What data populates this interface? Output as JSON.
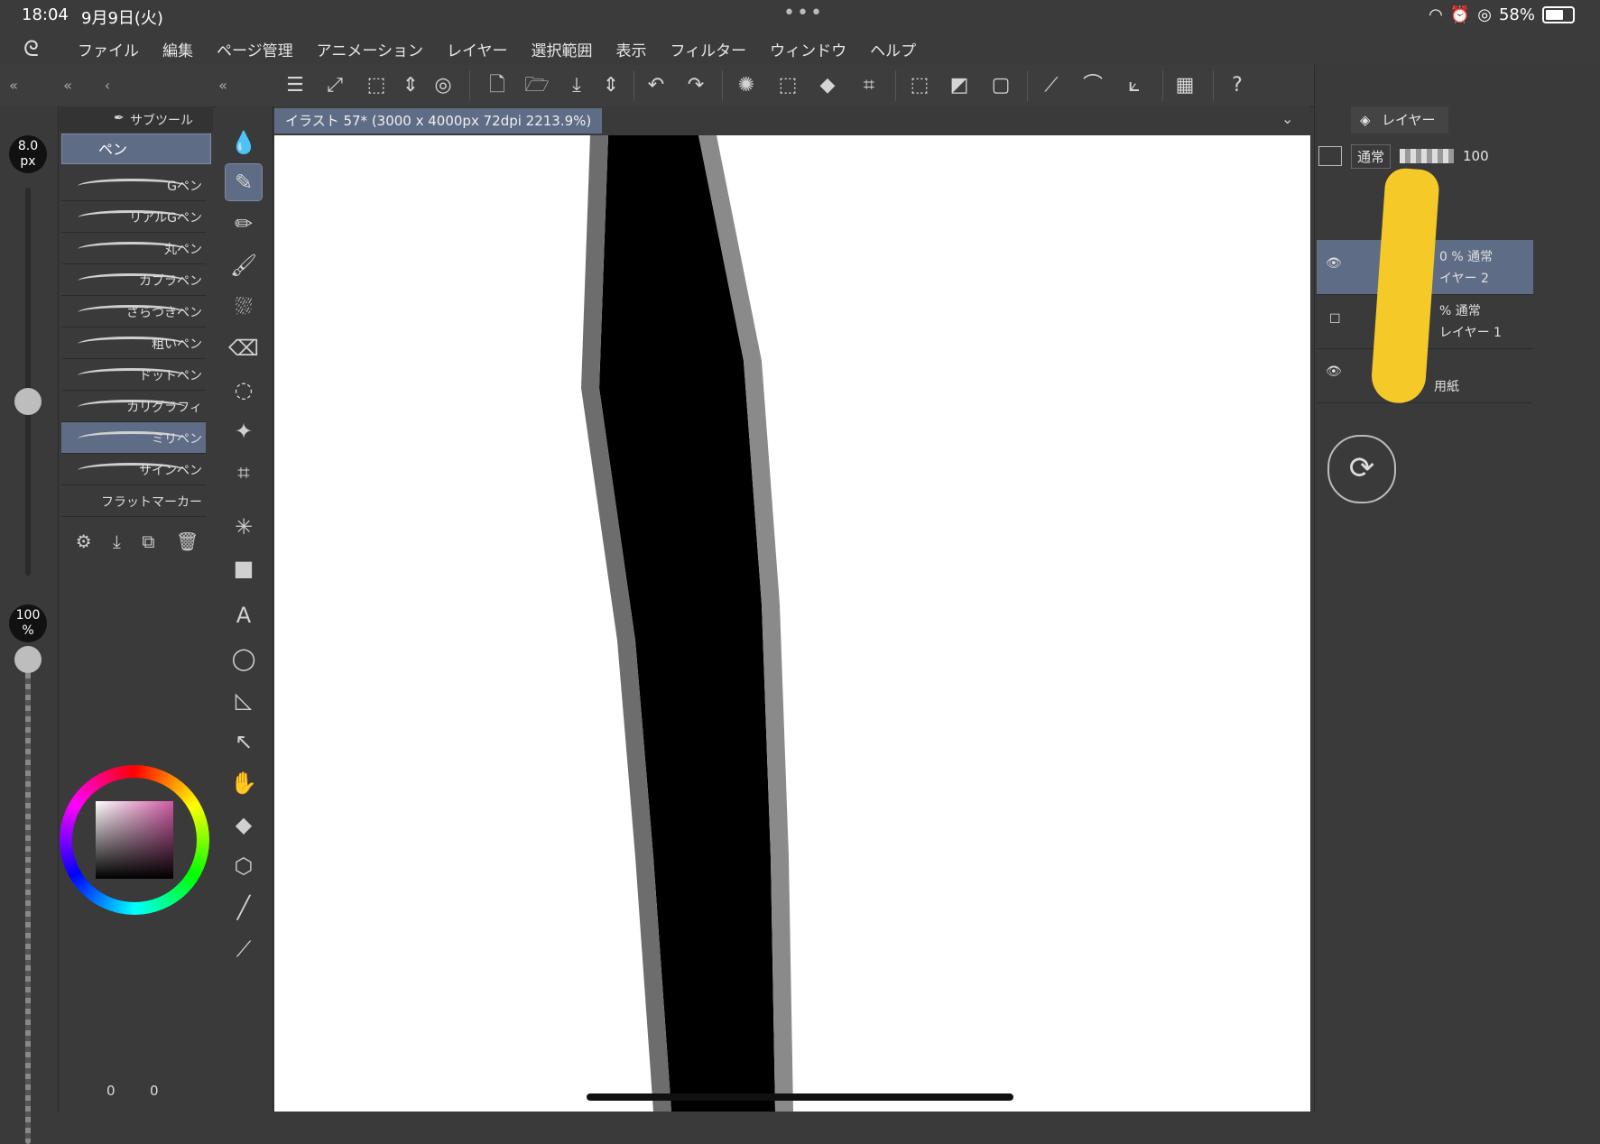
{
  "statusbar": {
    "time": "18:04",
    "date": "9月9日(火)",
    "battery_percent": "58%"
  },
  "menubar": {
    "items": [
      "ファイル",
      "編集",
      "ページ管理",
      "アニメーション",
      "レイヤー",
      "選択範囲",
      "表示",
      "フィルター",
      "ウィンドウ",
      "ヘルプ"
    ]
  },
  "brush_size": {
    "value": "8.0",
    "unit": "px"
  },
  "opacity": {
    "value": "100",
    "unit": "%"
  },
  "subtool": {
    "tab_label": "サブツール",
    "group_label": "ペン",
    "brushes": [
      "Gペン",
      "リアルGペン",
      "丸ペン",
      "カブラペン",
      "ざらつきペン",
      "粗いペン",
      "ドットペン",
      "カリグラフィ",
      "ミリペン",
      "サインペン",
      "フラットマーカー"
    ],
    "selected_index": 8
  },
  "canvas": {
    "tab_title": "イラスト 57* (3000 x 4000px 72dpi 2213.9%)"
  },
  "layers": {
    "tab_label": "レイヤー",
    "blend_mode": "通常",
    "opacity_value": "100",
    "rows": [
      {
        "line1": "0 % 通常",
        "line2": "イヤー 2"
      },
      {
        "line1": "% 通常",
        "line2": "レイヤー 1"
      },
      {
        "line1": "",
        "line2": "用紙"
      }
    ]
  },
  "counters": {
    "left": "0",
    "right": "0"
  },
  "colors": {
    "accent": "#5f6c85",
    "panel": "#3a3a3a",
    "highlight": "#f5c928"
  }
}
